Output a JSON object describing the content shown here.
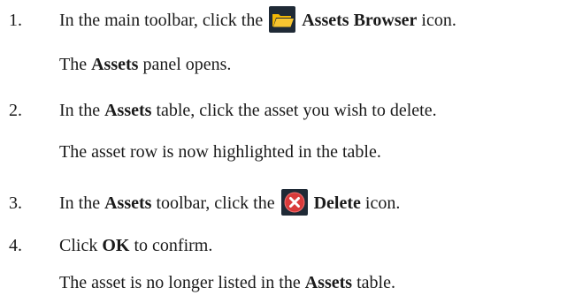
{
  "steps": [
    {
      "number": "1.",
      "before": "In the main toolbar, click the",
      "strong": "Assets Browser",
      "after": "icon.",
      "icon": "folder-open-icon",
      "result_before": "The",
      "result_strong": "Assets",
      "result_after": "panel opens."
    },
    {
      "number": "2.",
      "before": "In the",
      "strong": "Assets",
      "after": "table, click the asset you wish to delete.",
      "result": "The asset row is now highlighted in the table."
    },
    {
      "number": "3.",
      "before": "In the",
      "strong": "Assets",
      "middle": "toolbar, click the",
      "strong2": "Delete",
      "after": "icon.",
      "icon": "delete-x-icon"
    },
    {
      "number": "4.",
      "before": "Click",
      "strong": "OK",
      "after": "to confirm.",
      "result_before": "The asset is no longer listed in the",
      "result_strong": "Assets",
      "result_after": "table."
    }
  ],
  "colors": {
    "text": "#1a1a1a",
    "folder_bg": "#1f2a36",
    "folder_yellow": "#f2b705",
    "delete_bg": "#1f2a36",
    "delete_red": "#d93b3b"
  }
}
